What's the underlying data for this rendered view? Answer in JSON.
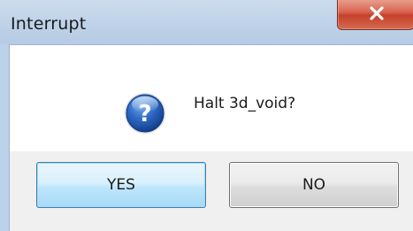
{
  "window": {
    "title": "Interrupt",
    "close_icon": "close-x-icon"
  },
  "dialog": {
    "icon": "question-icon",
    "message": "Halt 3d_void?"
  },
  "buttons": {
    "yes_label": "YES",
    "no_label": "NO"
  },
  "colors": {
    "close_button": "#c6412c",
    "question_icon": "#1e5fb4",
    "default_button_border": "#3c7fb1"
  }
}
